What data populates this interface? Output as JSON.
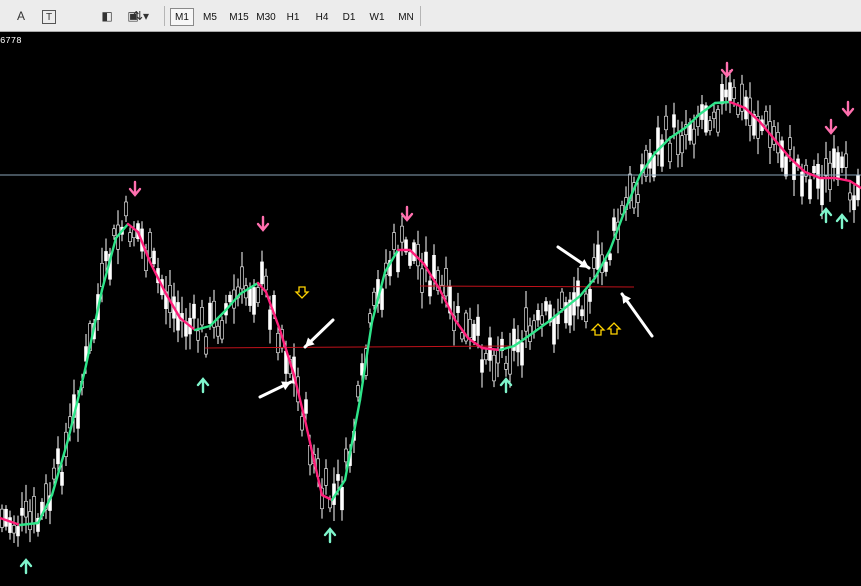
{
  "toolbar": {
    "tools": [
      {
        "name": "text-tool",
        "glyph": "A"
      },
      {
        "name": "text-label-tool",
        "glyph": "T"
      },
      {
        "name": "eraser-tool",
        "glyph": "◧"
      },
      {
        "name": "rectangle-tool",
        "glyph": "▣"
      },
      {
        "name": "arrows-tool",
        "glyph": "⇅▾"
      }
    ],
    "timeframes": [
      "M1",
      "M5",
      "M15",
      "M30",
      "H1",
      "H4",
      "D1",
      "W1",
      "MN"
    ],
    "active_timeframe": "M1"
  },
  "chart": {
    "price_label": "6778",
    "colors": {
      "background": "#000000",
      "candle": "#ffffff",
      "ma_up": "#2ee58a",
      "ma_down": "#ff1f7a",
      "level_line": "#c0111a",
      "hline": "#8aa3b8",
      "arrow_down": "#ff6fae",
      "arrow_up": "#7ff5cc",
      "signal_hollow": "#ffd400",
      "annotation": "#ffffff"
    }
  }
}
